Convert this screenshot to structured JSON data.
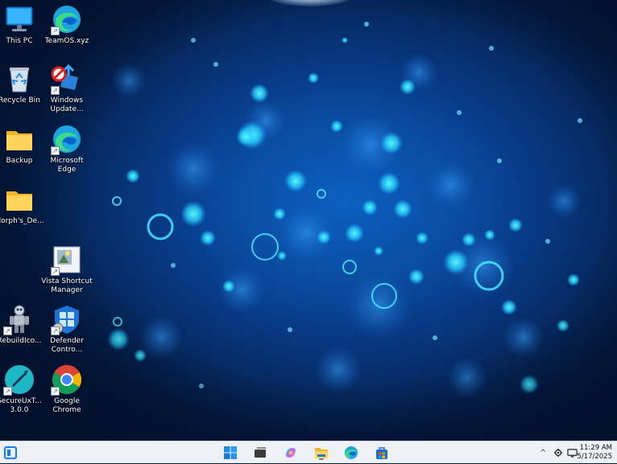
{
  "desktop": {
    "icons": [
      {
        "label_1": "This PC",
        "label_2": ""
      },
      {
        "label_1": "TeamOS.xyz",
        "label_2": ""
      },
      {
        "label_1": "Recycle Bin",
        "label_2": ""
      },
      {
        "label_1": "Windows",
        "label_2": "Update..."
      },
      {
        "label_1": "Backup",
        "label_2": ""
      },
      {
        "label_1": "Microsoft",
        "label_2": "Edge"
      },
      {
        "label_1": "Morph's_De...",
        "label_2": ""
      },
      {
        "label_1": "Vista Shortcut",
        "label_2": "Manager"
      },
      {
        "label_1": "RebuildIco...",
        "label_2": ""
      },
      {
        "label_1": "Defender",
        "label_2": "Contro..."
      },
      {
        "label_1": "SecureUxT...",
        "label_2": "3.0.0"
      },
      {
        "label_1": "Google",
        "label_2": "Chrome"
      }
    ]
  },
  "taskbar": {
    "start_icon": "start-icon",
    "pinned": [
      "task-view-icon",
      "copilot-icon",
      "file-explorer-icon",
      "edge-icon",
      "store-icon"
    ],
    "tray": {
      "chevron": "^",
      "time": "11:29 AM",
      "date": "5/17/2025"
    }
  },
  "colors": {
    "taskbar_bg": "#eef1f6",
    "accent": "#0a7cff",
    "desktop_deep": "#041b45"
  }
}
